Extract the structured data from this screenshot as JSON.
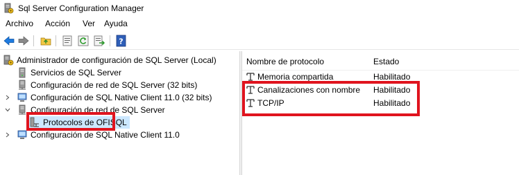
{
  "window": {
    "title": "Sql Server Configuration Manager"
  },
  "menu": {
    "items": [
      "Archivo",
      "Acción",
      "Ver",
      "Ayuda"
    ]
  },
  "toolbar": {
    "buttons": [
      "back-icon",
      "forward-icon",
      "up-folder-icon",
      "properties-icon",
      "refresh-icon",
      "export-list-icon",
      "help-icon"
    ]
  },
  "tree": {
    "root": "Administrador de configuración de SQL Server (Local)",
    "items": [
      "Servicios de SQL Server",
      "Configuración de red de SQL Server (32 bits)",
      "Configuración de SQL Native Client 11.0 (32 bits)",
      "Configuración de red de SQL Server",
      "Protocolos de OFISQL",
      "Configuración de SQL Native Client 11.0"
    ]
  },
  "list": {
    "columns": [
      "Nombre de protocolo",
      "Estado"
    ],
    "rows": [
      {
        "name": "Memoria compartida",
        "state": "Habilitado"
      },
      {
        "name": "Canalizaciones con nombre",
        "state": "Habilitado"
      },
      {
        "name": "TCP/IP",
        "state": "Habilitado"
      }
    ]
  },
  "colors": {
    "highlight_box": "#e0141e",
    "selected_bg": "#cce8ff"
  }
}
